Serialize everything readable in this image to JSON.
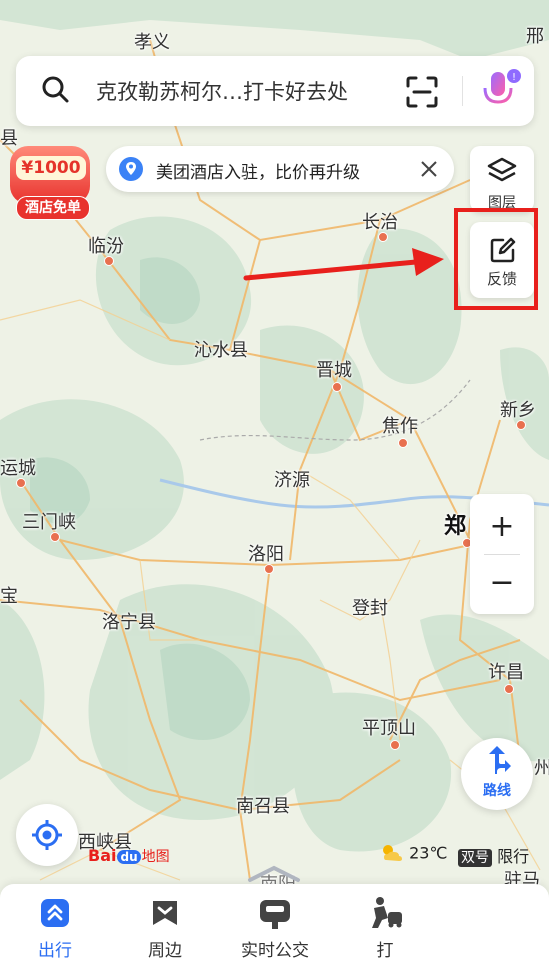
{
  "search": {
    "text": "克孜勒苏柯尔…打卡好去处"
  },
  "promo": {
    "amount": "¥1000",
    "label": "酒店免单"
  },
  "banner": {
    "text": "美团酒店入驻，比价再升级"
  },
  "side_buttons": {
    "layers": "图层",
    "feedback": "反馈",
    "route": "路线"
  },
  "zoom": {
    "in": "+",
    "out": "−"
  },
  "status": {
    "weather": "23℃",
    "plate_tag": "双号",
    "plate_text": "限行"
  },
  "brand": {
    "bai": "Bai",
    "du": "du",
    "map": "地图"
  },
  "cities": {
    "xiaoyi": "孝义",
    "xing": "邢",
    "linfen": "临汾",
    "changzhi": "长治",
    "qinshui": "沁水县",
    "jincheng": "晋城",
    "xinxiang": "新乡",
    "jiaozuo": "焦作",
    "yuncheng": "运城",
    "jiyuan": "济源",
    "sanmenxia": "三门峡",
    "zheng": "郑",
    "luoyang": "洛阳",
    "bao": "宝",
    "luoning": "洛宁县",
    "dengfeng": "登封",
    "xuchang": "许昌",
    "pingdingshan": "平顶山",
    "nanzhao": "南召县",
    "xixia": "西峡县",
    "nanyang": "南阳",
    "zhuma": "驻马",
    "xian_left": "县",
    "zhou": "州"
  },
  "tabs": [
    {
      "label": "出行",
      "icon": "travel-icon"
    },
    {
      "label": "周边",
      "icon": "nearby-icon"
    },
    {
      "label": "实时公交",
      "icon": "bus-icon"
    },
    {
      "label": "打",
      "icon": "taxi-icon"
    }
  ],
  "colors": {
    "accent": "#2b6ef2",
    "annotation": "#e8201c",
    "city_dot": "#e8704f",
    "river": "#a9c9ea"
  }
}
